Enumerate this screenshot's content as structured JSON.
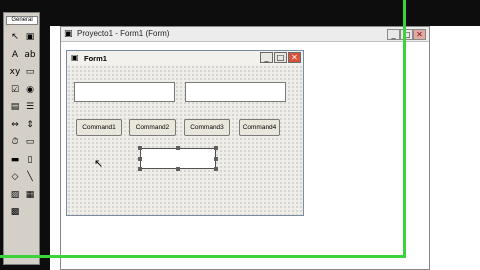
{
  "toolbox": {
    "tab_label": "General",
    "tools": [
      {
        "name": "pointer-icon",
        "glyph": "↖"
      },
      {
        "name": "picturebox-icon",
        "glyph": "▣"
      },
      {
        "name": "label-icon",
        "glyph": "A"
      },
      {
        "name": "textbox-icon",
        "glyph": "ab"
      },
      {
        "name": "frame-icon",
        "glyph": "xy"
      },
      {
        "name": "commandbutton-icon",
        "glyph": "▭"
      },
      {
        "name": "checkbox-icon",
        "glyph": "☑"
      },
      {
        "name": "optionbutton-icon",
        "glyph": "◉"
      },
      {
        "name": "combobox-icon",
        "glyph": "▤"
      },
      {
        "name": "listbox-icon",
        "glyph": "☰"
      },
      {
        "name": "hscrollbar-icon",
        "glyph": "⇔"
      },
      {
        "name": "vscrollbar-icon",
        "glyph": "⇕"
      },
      {
        "name": "timer-icon",
        "glyph": "⏱"
      },
      {
        "name": "drivelistbox-icon",
        "glyph": "▭"
      },
      {
        "name": "dirlistbox-icon",
        "glyph": "▬"
      },
      {
        "name": "filelistbox-icon",
        "glyph": "▯"
      },
      {
        "name": "shape-icon",
        "glyph": "◇"
      },
      {
        "name": "line-icon",
        "glyph": "╲"
      },
      {
        "name": "image-icon",
        "glyph": "▨"
      },
      {
        "name": "data-icon",
        "glyph": "▦"
      },
      {
        "name": "ole-icon",
        "glyph": "▩"
      }
    ]
  },
  "project_window": {
    "title": "Proyecto1 - Form1 (Form)"
  },
  "form": {
    "title": "Form1",
    "buttons": [
      "Command1",
      "Command2",
      "Command3",
      "Command4"
    ]
  },
  "colors": {
    "highlight_border": "#3cd23c"
  }
}
